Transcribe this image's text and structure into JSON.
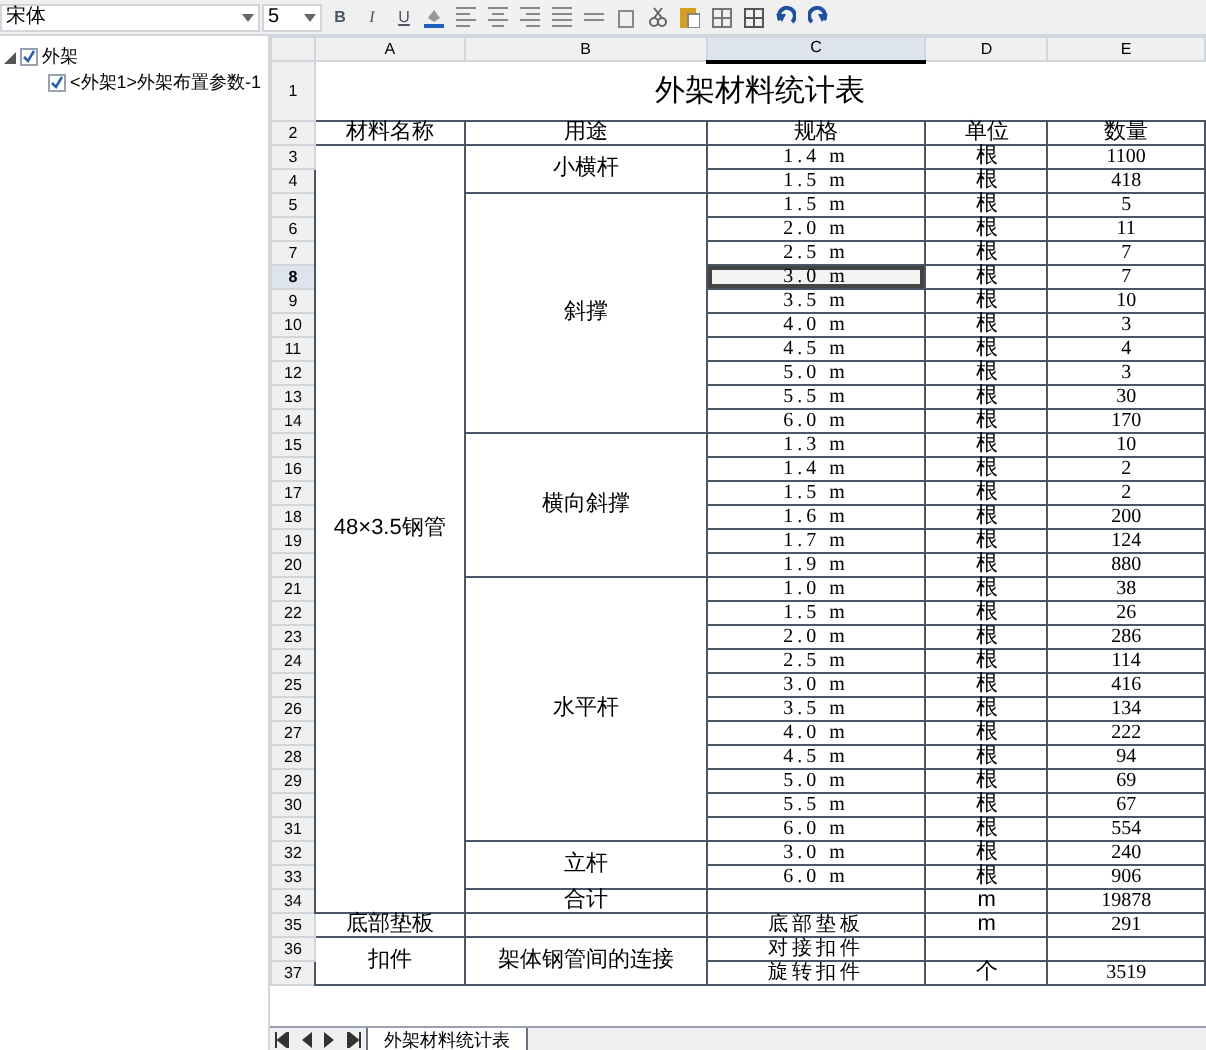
{
  "toolbar": {
    "font": "宋体",
    "size": "5",
    "format_buttons": [
      "B",
      "I",
      "U"
    ]
  },
  "tree": [
    {
      "label": "外架",
      "checked": true,
      "expanded": true,
      "children": [
        {
          "label": "<外架1>外架布置参数-1",
          "checked": true
        }
      ]
    }
  ],
  "sheet": {
    "columns": [
      {
        "label": "A",
        "selected": false
      },
      {
        "label": "B",
        "selected": false
      },
      {
        "label": "C",
        "selected": true
      },
      {
        "label": "D",
        "selected": false
      },
      {
        "label": "E",
        "selected": false
      }
    ],
    "row_headers": [
      {
        "label": "1",
        "selected": false
      },
      {
        "label": "2",
        "selected": false
      },
      {
        "label": "3",
        "selected": false
      },
      {
        "label": "4",
        "selected": false
      },
      {
        "label": "5",
        "selected": false
      },
      {
        "label": "6",
        "selected": false
      },
      {
        "label": "7",
        "selected": false
      },
      {
        "label": "8",
        "selected": true
      },
      {
        "label": "9",
        "selected": false
      },
      {
        "label": "10",
        "selected": false
      },
      {
        "label": "11",
        "selected": false
      },
      {
        "label": "12",
        "selected": false
      },
      {
        "label": "13",
        "selected": false
      },
      {
        "label": "14",
        "selected": false
      },
      {
        "label": "15",
        "selected": false
      },
      {
        "label": "16",
        "selected": false
      },
      {
        "label": "17",
        "selected": false
      },
      {
        "label": "18",
        "selected": false
      },
      {
        "label": "19",
        "selected": false
      },
      {
        "label": "20",
        "selected": false
      },
      {
        "label": "21",
        "selected": false
      },
      {
        "label": "22",
        "selected": false
      },
      {
        "label": "23",
        "selected": false
      },
      {
        "label": "24",
        "selected": false
      },
      {
        "label": "25",
        "selected": false
      },
      {
        "label": "26",
        "selected": false
      },
      {
        "label": "27",
        "selected": false
      },
      {
        "label": "28",
        "selected": false
      },
      {
        "label": "29",
        "selected": false
      },
      {
        "label": "30",
        "selected": false
      },
      {
        "label": "31",
        "selected": false
      },
      {
        "label": "32",
        "selected": false
      },
      {
        "label": "33",
        "selected": false
      },
      {
        "label": "34",
        "selected": false
      },
      {
        "label": "35",
        "selected": false
      },
      {
        "label": "36",
        "selected": false
      },
      {
        "label": "37",
        "selected": false
      }
    ],
    "title": "外架材料统计表",
    "headers": [
      "材料名称",
      "用途",
      "规格",
      "单位",
      "数量"
    ],
    "materials": [
      {
        "name": "48×3.5钢管",
        "usages": [
          {
            "name": "小横杆",
            "items": [
              {
                "spec": "1.4 m",
                "unit": "根",
                "qty": "1100",
                "selected": false
              },
              {
                "spec": "1.5 m",
                "unit": "根",
                "qty": "418",
                "selected": false
              }
            ]
          },
          {
            "name": "斜撑",
            "items": [
              {
                "spec": "1.5 m",
                "unit": "根",
                "qty": "5",
                "selected": false
              },
              {
                "spec": "2.0 m",
                "unit": "根",
                "qty": "11",
                "selected": false
              },
              {
                "spec": "2.5 m",
                "unit": "根",
                "qty": "7",
                "selected": false
              },
              {
                "spec": "3.0 m",
                "unit": "根",
                "qty": "7",
                "selected": true
              },
              {
                "spec": "3.5 m",
                "unit": "根",
                "qty": "10",
                "selected": false
              },
              {
                "spec": "4.0 m",
                "unit": "根",
                "qty": "3",
                "selected": false
              },
              {
                "spec": "4.5 m",
                "unit": "根",
                "qty": "4",
                "selected": false
              },
              {
                "spec": "5.0 m",
                "unit": "根",
                "qty": "3",
                "selected": false
              },
              {
                "spec": "5.5 m",
                "unit": "根",
                "qty": "30",
                "selected": false
              },
              {
                "spec": "6.0 m",
                "unit": "根",
                "qty": "170",
                "selected": false
              }
            ]
          },
          {
            "name": "横向斜撑",
            "items": [
              {
                "spec": "1.3 m",
                "unit": "根",
                "qty": "10",
                "selected": false
              },
              {
                "spec": "1.4 m",
                "unit": "根",
                "qty": "2",
                "selected": false
              },
              {
                "spec": "1.5 m",
                "unit": "根",
                "qty": "2",
                "selected": false
              },
              {
                "spec": "1.6 m",
                "unit": "根",
                "qty": "200",
                "selected": false
              },
              {
                "spec": "1.7 m",
                "unit": "根",
                "qty": "124",
                "selected": false
              },
              {
                "spec": "1.9 m",
                "unit": "根",
                "qty": "880",
                "selected": false
              }
            ]
          },
          {
            "name": "水平杆",
            "items": [
              {
                "spec": "1.0 m",
                "unit": "根",
                "qty": "38",
                "selected": false
              },
              {
                "spec": "1.5 m",
                "unit": "根",
                "qty": "26",
                "selected": false
              },
              {
                "spec": "2.0 m",
                "unit": "根",
                "qty": "286",
                "selected": false
              },
              {
                "spec": "2.5 m",
                "unit": "根",
                "qty": "114",
                "selected": false
              },
              {
                "spec": "3.0 m",
                "unit": "根",
                "qty": "416",
                "selected": false
              },
              {
                "spec": "3.5 m",
                "unit": "根",
                "qty": "134",
                "selected": false
              },
              {
                "spec": "4.0 m",
                "unit": "根",
                "qty": "222",
                "selected": false
              },
              {
                "spec": "4.5 m",
                "unit": "根",
                "qty": "94",
                "selected": false
              },
              {
                "spec": "5.0 m",
                "unit": "根",
                "qty": "69",
                "selected": false
              },
              {
                "spec": "5.5 m",
                "unit": "根",
                "qty": "67",
                "selected": false
              },
              {
                "spec": "6.0 m",
                "unit": "根",
                "qty": "554",
                "selected": false
              }
            ]
          },
          {
            "name": "立杆",
            "items": [
              {
                "spec": "3.0 m",
                "unit": "根",
                "qty": "240",
                "selected": false
              },
              {
                "spec": "6.0 m",
                "unit": "根",
                "qty": "906",
                "selected": false
              }
            ]
          },
          {
            "name": "合计",
            "items": [
              {
                "unit": "m",
                "qty": "19878",
                "selected": false
              }
            ]
          }
        ]
      },
      {
        "name": "底部垫板",
        "usages": [
          {
            "items": [
              {
                "spec": "底部垫板",
                "unit": "m",
                "qty": "291",
                "selected": false
              }
            ]
          }
        ]
      },
      {
        "name": "扣件",
        "usages": [
          {
            "name": "架体钢管间的连接",
            "items": [
              {
                "spec": "对接扣件",
                "selected": false
              },
              {
                "spec": "旋转扣件",
                "unit": "个",
                "qty": "3519",
                "selected": false
              }
            ]
          }
        ]
      }
    ],
    "sheet_tabs": [
      {
        "label": "外架材料统计表",
        "selected": true
      }
    ]
  }
}
